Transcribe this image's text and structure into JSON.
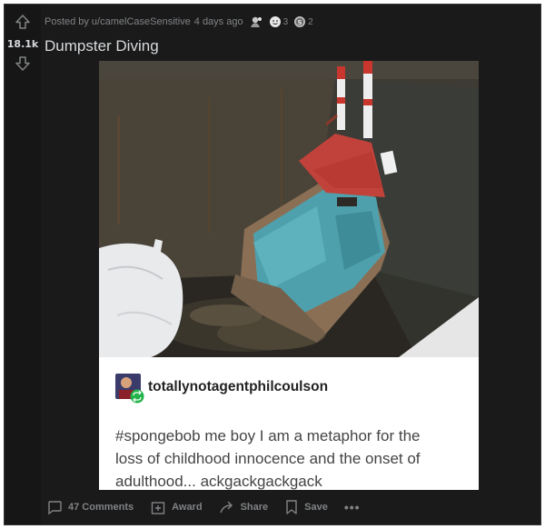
{
  "post": {
    "posted_by_prefix": "Posted by",
    "author": "u/camelCaseSensitive",
    "time": "4 days ago",
    "awards": [
      {
        "icon": "helper-award-icon",
        "count": ""
      },
      {
        "icon": "wholesome-award-icon",
        "count": "3"
      },
      {
        "icon": "silver-award-icon",
        "count": "2"
      }
    ],
    "score": "18.1k",
    "title": "Dumpster Diving",
    "image": {
      "username": "totallynotagentphilcoulson",
      "caption_lines": [
        "#spongebob me boy I am a metaphor for the",
        "loss of childhood innocence and the onset of",
        "adulthood... ackgackgackgack"
      ]
    }
  },
  "actions": {
    "comments": "47 Comments",
    "award": "Award",
    "share": "Share",
    "save": "Save",
    "more": "•••"
  },
  "colors": {
    "card_bg": "#1a1a1b",
    "text": "#d7dadc",
    "muted": "#818384"
  }
}
